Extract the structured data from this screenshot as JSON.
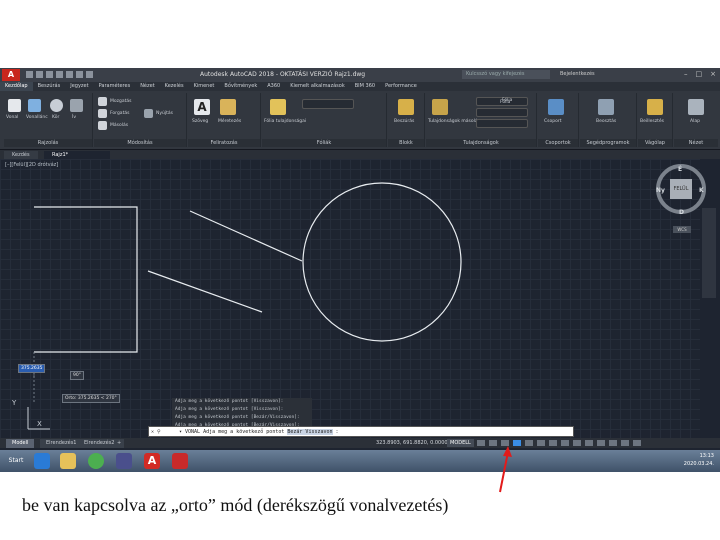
{
  "window": {
    "title": "Autodesk AutoCAD 2018 - OKTATÁSI VERZIÓ     Rajz1.dwg",
    "search_placeholder": "Kulcsszó vagy kifejezés",
    "user": "Bejelentkezés",
    "controls": [
      "–",
      "□",
      "×"
    ]
  },
  "menubar": {
    "items": [
      "Kezdőlap",
      "Beszúrás",
      "Jegyzet",
      "Paraméteres",
      "Nézet",
      "Kezelés",
      "Kimenet",
      "Bővítmények",
      "A360",
      "Kiemelt alkalmazások",
      "BIM 360",
      "Performance"
    ]
  },
  "ribbon": {
    "groups": [
      {
        "label": "Rajzolás",
        "tools": [
          "Vonal",
          "Vonallánc",
          "Kör",
          "Ív"
        ]
      },
      {
        "label": "Módosítás",
        "tools": [
          "Mozgatás",
          "Forgatás",
          "Másolás",
          "Nyújtás"
        ]
      },
      {
        "label": "Feliratozás",
        "tools": [
          "Szöveg",
          "Méretezés"
        ]
      },
      {
        "label": "Fóliák",
        "tools": [
          "Fólia tulajdonságai"
        ]
      },
      {
        "label": "Blokk",
        "tools": [
          "Beszúrás"
        ]
      },
      {
        "label": "Tulajdonságok",
        "tools": [
          "Tulajdonságok másolása"
        ]
      },
      {
        "label": "Csoportok",
        "tools": [
          "Csoport"
        ]
      },
      {
        "label": "Segédprogramok",
        "tools": [
          "Beosztás"
        ]
      },
      {
        "label": "Vágólap",
        "tools": [
          "Beillesztés"
        ]
      },
      {
        "label": "Nézet",
        "tools": [
          "Alap"
        ]
      }
    ],
    "layer_value": "Fólia",
    "prop_value": "Fólia"
  },
  "doc_tabs": [
    "Kezdés",
    "Rajz1*"
  ],
  "viewport": {
    "label": "[–][Felül][2D drótváz]",
    "viewcube": {
      "face": "FELÜL",
      "n": "É",
      "s": "D",
      "w": "Ny",
      "e": "K"
    },
    "wcs": "WCS",
    "tooltips": [
      "375.2635",
      "90°",
      "Orto: 375.2635 < 270°"
    ],
    "ucs_x": "X",
    "ucs_y": "Y"
  },
  "command": {
    "history": [
      "Adja meg a következő pontot [Visszavon]:",
      "Adja meg a következő pontot [Visszavon]:",
      "Adja meg a következő pontot [Bezár/Visszavon]:",
      "Adja meg a következő pontot [Bezár/Visszavon]:"
    ],
    "prompt": "▾ VONAL Adja meg a következő pontot",
    "options": "Bezár Visszavon",
    "close_x": "✕ ⚲"
  },
  "status": {
    "layout_tabs": [
      "Modell",
      "Elrendezés1",
      "Elrendezés2",
      "+"
    ],
    "coords": "323.8903, 691.8820, 0.0000",
    "model": "MODELL",
    "ortho_on": true
  },
  "taskbar": {
    "start": "Start",
    "time": "13:13",
    "date": "2020.03.24."
  },
  "caption": "be van kapcsolva az „orto” mód (derékszögű vonalvezetés)",
  "colors": {
    "background": "#1e2430",
    "arrow": "#e21b1b",
    "drawing": "#e8ecf0",
    "ortho_highlight": "#3a8ee6"
  }
}
